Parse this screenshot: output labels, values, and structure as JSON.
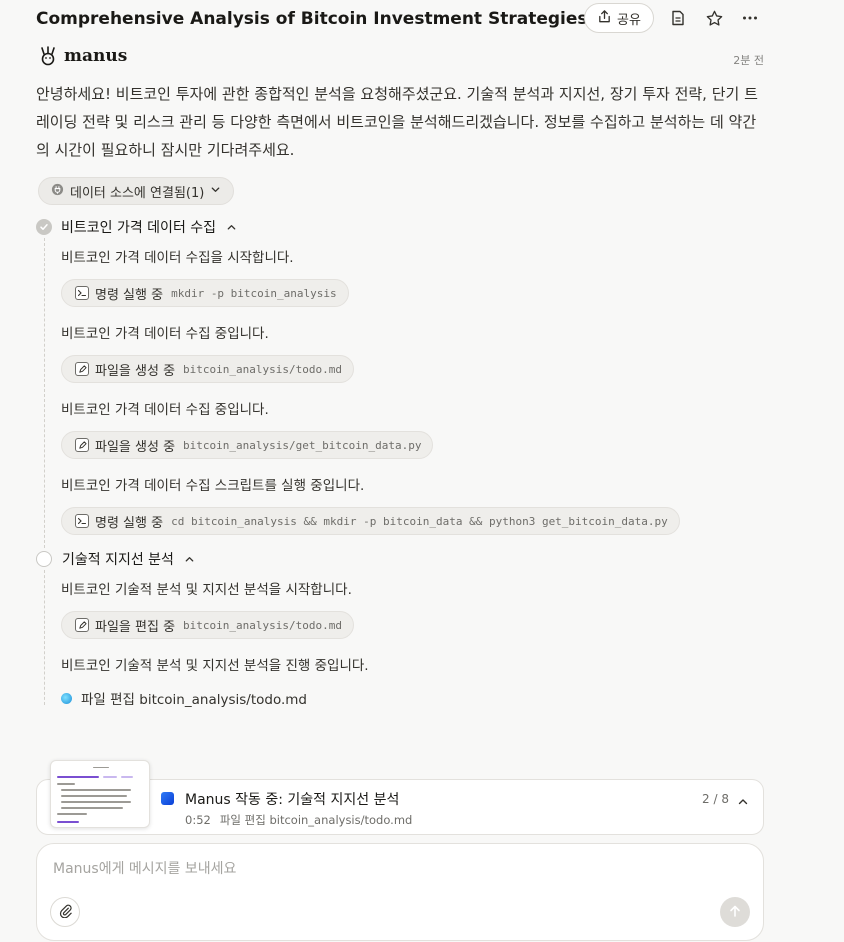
{
  "header": {
    "title": "Comprehensive Analysis of Bitcoin Investment Strategies",
    "share_label": "공유",
    "icons": [
      "share-icon",
      "document-icon",
      "star-icon",
      "more-icon"
    ]
  },
  "agent": {
    "name": "manus",
    "time": "2분 전"
  },
  "intro": "안녕하세요! 비트코인 투자에 관한 종합적인 분석을 요청해주셨군요. 기술적 분석과 지지선, 장기 투자 전략, 단기 트레이딩 전략 및 리스크 관리 등 다양한 측면에서 비트코인을 분석해드리겠습니다. 정보를 수집하고 분석하는 데 약간의 시간이 필요하니 잠시만 기다려주세요.",
  "data_source": {
    "label": "데이터 소스에 연결됨(1)"
  },
  "steps": [
    {
      "title": "비트코인 가격 데이터 수집",
      "status": "done",
      "entries": [
        {
          "text": "비트코인 가격 데이터 수집을 시작합니다.",
          "tool_label": "명령 실행 중",
          "tool_arg": "mkdir -p bitcoin_analysis",
          "tool_icon": "terminal-icon"
        },
        {
          "text": "비트코인 가격 데이터 수집 중입니다.",
          "tool_label": "파일을 생성 중",
          "tool_arg": "bitcoin_analysis/todo.md",
          "tool_icon": "edit-icon"
        },
        {
          "text": "비트코인 가격 데이터 수집 중입니다.",
          "tool_label": "파일을 생성 중",
          "tool_arg": "bitcoin_analysis/get_bitcoin_data.py",
          "tool_icon": "edit-icon"
        },
        {
          "text": "비트코인 가격 데이터 수집 스크립트를 실행 중입니다.",
          "tool_label": "명령 실행 중",
          "tool_arg": "cd bitcoin_analysis && mkdir -p bitcoin_data && python3 get_bitcoin_data.py",
          "tool_icon": "terminal-icon"
        }
      ]
    },
    {
      "title": "기술적 지지선 분석",
      "status": "in_progress",
      "entries": [
        {
          "text": "비트코인 기술적 분석 및 지지선 분석을 시작합니다.",
          "tool_label": "파일을 편집 중",
          "tool_arg": "bitcoin_analysis/todo.md",
          "tool_icon": "edit-icon"
        },
        {
          "text": "비트코인 기술적 분석 및 지지선 분석을 진행 중입니다."
        }
      ],
      "active": "파일 편집 bitcoin_analysis/todo.md"
    }
  ],
  "status_bar": {
    "title": "Manus 작동 중: 기술적 지지선 분석",
    "time": "0:52",
    "detail": "파일 편집 bitcoin_analysis/todo.md",
    "progress": "2 / 8"
  },
  "composer": {
    "placeholder": "Manus에게 메시지를 보내세요"
  },
  "colors": {
    "accent": "#2f7bf6",
    "background": "#f8f8f7",
    "text": "#34322d"
  }
}
